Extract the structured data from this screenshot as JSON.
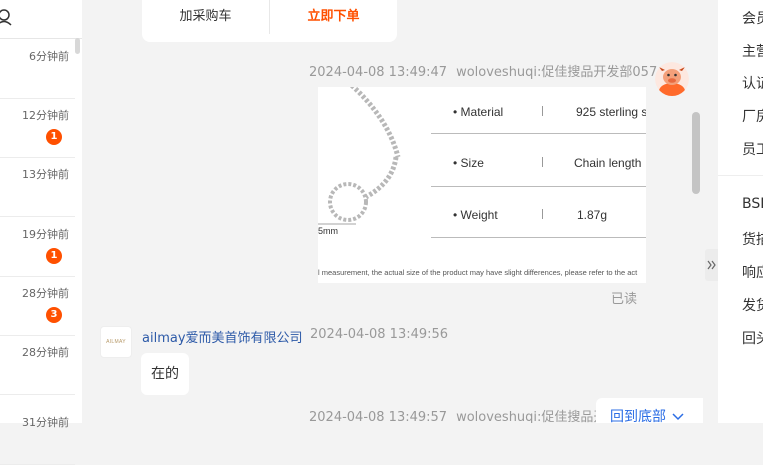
{
  "conversations": [
    {
      "time": "6分钟前",
      "badge": ""
    },
    {
      "time": "12分钟前",
      "badge": "1"
    },
    {
      "time": "13分钟前",
      "badge": ""
    },
    {
      "time": "19分钟前",
      "badge": "1"
    },
    {
      "time": "28分钟前",
      "badge": "3"
    },
    {
      "time": "28分钟前",
      "badge": ""
    },
    {
      "time": "31分钟前",
      "badge": ""
    }
  ],
  "card": {
    "add_cart": "加采购车",
    "order_now": "立即下单"
  },
  "messages": {
    "m1": {
      "time": "2024-04-08 13:49:47",
      "sender": "woloveshuqi:促佳搜品开发部057",
      "read_status": "已读"
    },
    "product": {
      "rows": [
        {
          "label": "Material",
          "value": "925 sterling s"
        },
        {
          "label": "Size",
          "value": "Chain length"
        },
        {
          "label": "Weight",
          "value": "1.87g"
        }
      ],
      "dimension": "5mm",
      "disclaimer": "l measurement, the actual size of the product may have slight differences, please refer to the act"
    },
    "m2": {
      "sender": "ailmay爱而美首饰有限公司",
      "time": "2024-04-08 13:49:56",
      "text": "在的",
      "avatar_text": "AILMAY"
    },
    "m3": {
      "time": "2024-04-08 13:49:57",
      "sender": "woloveshuqi:促佳搜品开"
    }
  },
  "back_to_bottom": "回到底部",
  "right_panel": {
    "items_top": [
      "会员",
      "主营",
      "认证",
      "厂房",
      "员工"
    ],
    "items_bottom": [
      "BSR",
      "货描",
      "响应",
      "发货",
      "回头"
    ]
  },
  "colors": {
    "accent": "#ff5000",
    "link": "#2b6de5",
    "shop_name": "#2d5aa8"
  }
}
